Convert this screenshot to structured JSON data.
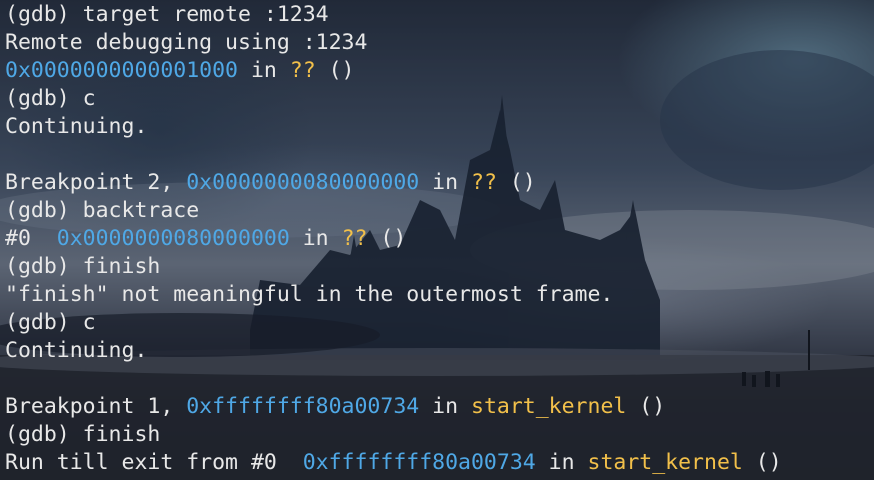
{
  "terminal": {
    "lines": [
      {
        "prefix": "(gdb) target remote :1234"
      },
      {
        "prefix": "Remote debugging using :1234"
      },
      {
        "addr": "0x0000000000001000",
        "mid": " in ",
        "sym": "??",
        "suffix": " ()"
      },
      {
        "prefix": "(gdb) c"
      },
      {
        "prefix": "Continuing."
      },
      {
        "prefix": ""
      },
      {
        "prefix": "Breakpoint 2, ",
        "addr": "0x0000000080000000",
        "mid": " in ",
        "sym": "??",
        "suffix": " ()"
      },
      {
        "prefix": "(gdb) backtrace"
      },
      {
        "prefix": "#0  ",
        "addr": "0x0000000080000000",
        "mid": " in ",
        "sym": "??",
        "suffix": " ()"
      },
      {
        "prefix": "(gdb) finish"
      },
      {
        "prefix": "\"finish\" not meaningful in the outermost frame."
      },
      {
        "prefix": "(gdb) c"
      },
      {
        "prefix": "Continuing."
      },
      {
        "prefix": ""
      },
      {
        "prefix": "Breakpoint 1, ",
        "addr": "0xffffffff80a00734",
        "mid": " in ",
        "sym": "start_kernel",
        "suffix": " ()"
      },
      {
        "prefix": "(gdb) finish"
      },
      {
        "prefix": "Run till exit from #0  ",
        "addr": "0xffffffff80a00734",
        "mid": " in ",
        "sym": "start_kernel",
        "suffix": " ()"
      }
    ]
  },
  "colors": {
    "text": "#e8e8e8",
    "address": "#4fa8e6",
    "symbol": "#f2c04a",
    "background": "#1d2533"
  }
}
